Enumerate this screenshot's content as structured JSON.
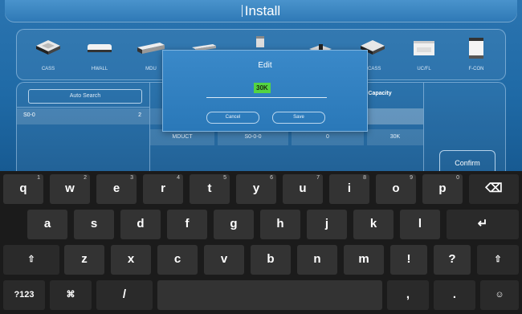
{
  "window": {
    "title": "Install"
  },
  "devices": [
    {
      "label": "CASS",
      "icon": "cassette-unit-icon"
    },
    {
      "label": "HWALL",
      "icon": "wall-unit-icon"
    },
    {
      "label": "MDU",
      "icon": "duct-unit-icon"
    },
    {
      "label": "",
      "icon": "slim-duct-icon"
    },
    {
      "label": "",
      "icon": "floor-standing-icon"
    },
    {
      "label": "",
      "icon": "ceiling-unit-icon"
    },
    {
      "label": "CCASS",
      "icon": "compact-cassette-icon"
    },
    {
      "label": "UC/FL",
      "icon": "console-unit-icon"
    },
    {
      "label": "F-CON",
      "icon": "floor-console-icon"
    }
  ],
  "panel": {
    "auto_search_label": "Auto Search",
    "group": {
      "name": "S0-0",
      "count": "2"
    },
    "capacity_header": "Capacity",
    "row": {
      "model": "MDUCT",
      "address": "S0-0-0",
      "value": "0",
      "capacity": "30K"
    },
    "confirm_label": "Confirm"
  },
  "dialog": {
    "title": "Edit",
    "value": "30K",
    "cancel_label": "Cancel",
    "save_label": "Save"
  },
  "keyboard": {
    "row1": [
      {
        "key": "q",
        "hint": "1"
      },
      {
        "key": "w",
        "hint": "2"
      },
      {
        "key": "e",
        "hint": "3"
      },
      {
        "key": "r",
        "hint": "4"
      },
      {
        "key": "t",
        "hint": "5"
      },
      {
        "key": "y",
        "hint": "6"
      },
      {
        "key": "u",
        "hint": "7"
      },
      {
        "key": "i",
        "hint": "8"
      },
      {
        "key": "o",
        "hint": "9"
      },
      {
        "key": "p",
        "hint": "0"
      }
    ],
    "row2": [
      "a",
      "s",
      "d",
      "f",
      "g",
      "h",
      "j",
      "k",
      "l"
    ],
    "row3": [
      "z",
      "x",
      "c",
      "v",
      "b",
      "n",
      "m",
      "!",
      "?"
    ],
    "shift_glyph": "⇧",
    "backspace_glyph": "⌫",
    "enter_glyph": "↵",
    "symbols_label": "?123",
    "settings_glyph": "⌘",
    "slash_label": "/",
    "comma_label": ",",
    "period_label": ".",
    "emoji_glyph": "☺"
  }
}
